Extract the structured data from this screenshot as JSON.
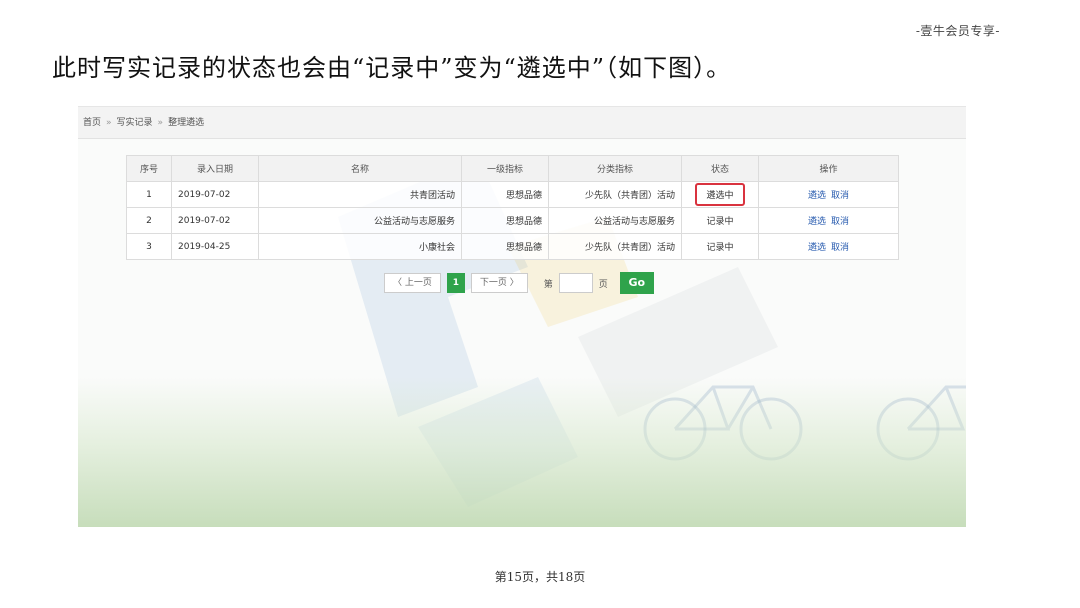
{
  "header_tag": "-壹牛会员专享-",
  "intro": "此时写实记录的状态也会由“记录中”变为“遴选中”（如下图）。",
  "breadcrumb": [
    "首页",
    "写实记录",
    "整理遴选"
  ],
  "breadcrumb_sep": "»",
  "table": {
    "headers": [
      "序号",
      "录入日期",
      "名称",
      "一级指标",
      "分类指标",
      "状态",
      "操作"
    ],
    "rows": [
      {
        "no": "1",
        "date": "2019-07-02",
        "name": "共青团活动",
        "level1": "思想品德",
        "category": "少先队（共青团）活动",
        "status": "遴选中",
        "op1": "遴选",
        "op2": "取消"
      },
      {
        "no": "2",
        "date": "2019-07-02",
        "name": "公益活动与志愿服务",
        "level1": "思想品德",
        "category": "公益活动与志愿服务",
        "status": "记录中",
        "op1": "遴选",
        "op2": "取消"
      },
      {
        "no": "3",
        "date": "2019-04-25",
        "name": "小康社会",
        "level1": "思想品德",
        "category": "少先队（共青团）活动",
        "status": "记录中",
        "op1": "遴选",
        "op2": "取消"
      }
    ]
  },
  "pager": {
    "prev": "〈 上一页",
    "current": "1",
    "next": "下一页 〉",
    "page_prefix": "第",
    "page_suffix": "页",
    "go": "Go"
  },
  "colors": {
    "accent_green": "#2fa34b",
    "highlight_red": "#d9333f",
    "link_blue": "#2a5db0"
  },
  "footer": "第15页，共18页"
}
